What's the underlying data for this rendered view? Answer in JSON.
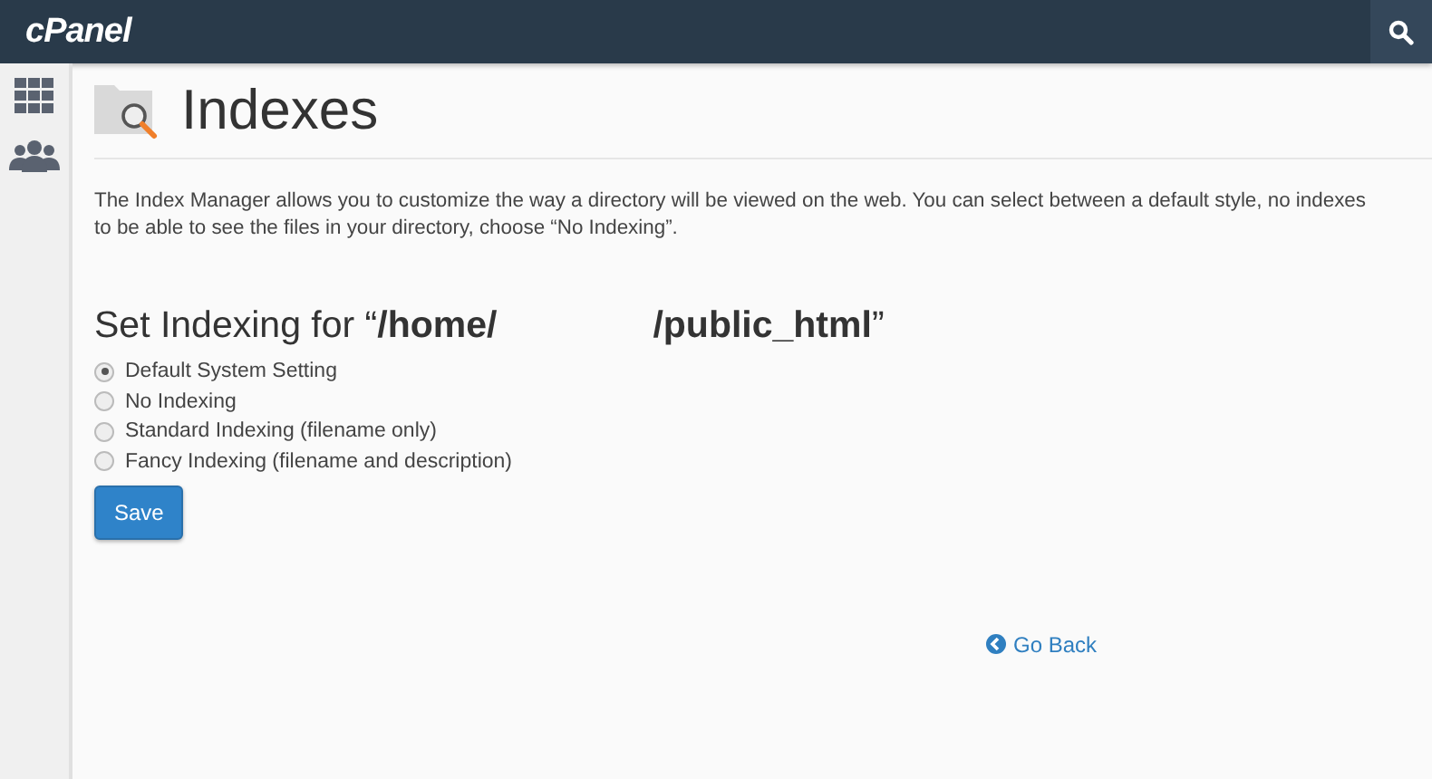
{
  "topbar": {
    "logo": "cPanel"
  },
  "page": {
    "title": "Indexes",
    "description": [
      "The Index Manager allows you to customize the way a directory will be viewed on the web. You can select between a default style, no indexes",
      "to be able to see the files in your directory, choose “No Indexing”."
    ],
    "heading": [
      "Set Indexing for “**/home/**",
      "**/public_html**”"
    ],
    "options": [
      {
        "label": "Default System Setting",
        "selected": true
      },
      {
        "label": "No Indexing",
        "selected": false
      },
      {
        "label": "Standard Indexing (filename only)",
        "selected": false
      },
      {
        "label": "Fancy Indexing (filename and description)",
        "selected": false
      }
    ],
    "save_button": "Save",
    "back_link": "Go Back"
  }
}
